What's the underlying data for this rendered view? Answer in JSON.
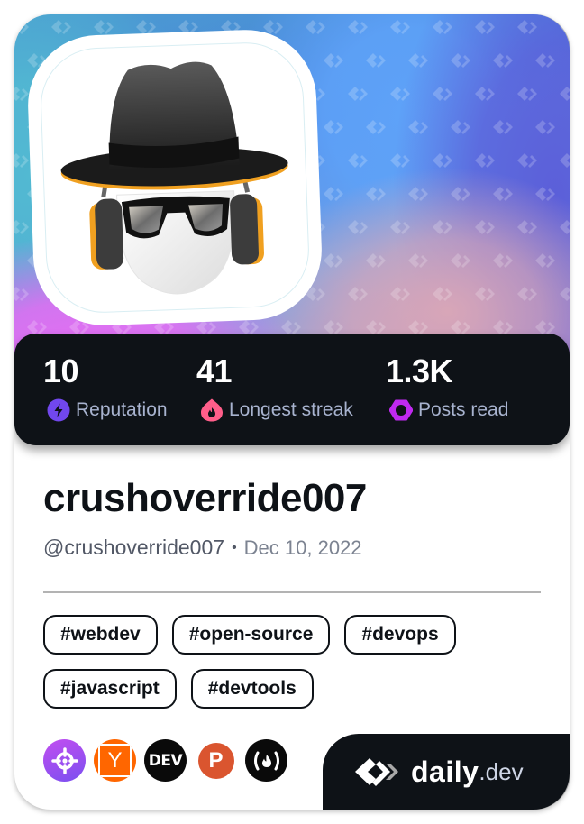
{
  "profile": {
    "display_name": "crushoverride007",
    "handle": "@crushoverride007",
    "separator": "•",
    "joined_date": "Dec 10, 2022",
    "avatar_icon": "incognito-hat-sunglasses-headphones-avatar"
  },
  "stats": [
    {
      "value": "10",
      "label": "Reputation",
      "icon": "lightning-bolt-icon",
      "color": "#7147ed"
    },
    {
      "value": "41",
      "label": "Longest streak",
      "icon": "flame-icon",
      "color": "#ff5e8a"
    },
    {
      "value": "1.3K",
      "label": "Posts read",
      "icon": "eye-ring-icon",
      "color": "#c029f0"
    }
  ],
  "tags": [
    [
      "#webdev",
      "#open-source",
      "#devops"
    ],
    [
      "#javascript",
      "#devtools"
    ]
  ],
  "sources": [
    {
      "name": "crosshair-source",
      "icon": "crosshair-icon",
      "color": "#9b4df0"
    },
    {
      "name": "hacker-news",
      "icon": "y-letter-icon",
      "glyph": "Y",
      "color": "#ff6600"
    },
    {
      "name": "dev-to",
      "icon": "dev-logo-icon",
      "glyph": "DEV",
      "color": "#0a0a0a"
    },
    {
      "name": "product-hunt",
      "icon": "p-letter-icon",
      "glyph": "P",
      "color": "#da552f"
    },
    {
      "name": "freecodecamp",
      "icon": "fcc-flame-icon",
      "glyph": "(🔥)",
      "color": "#0a0a0a"
    }
  ],
  "brand": {
    "word": "daily",
    "tld": ".dev"
  },
  "colors": {
    "dark": "#0e1217",
    "label": "#a8b3cf"
  }
}
